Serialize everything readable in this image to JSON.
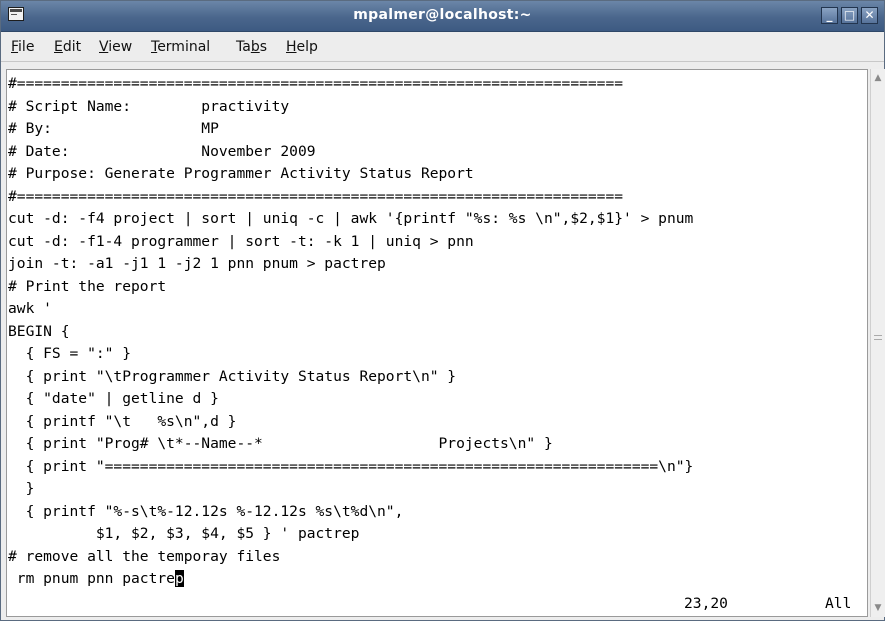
{
  "window": {
    "title": "mpalmer@localhost:~",
    "buttons": {
      "minimize": "_",
      "maximize": "□",
      "close": "✕"
    }
  },
  "menubar": [
    {
      "key": "F",
      "rest": "ile"
    },
    {
      "key": "E",
      "rest": "dit"
    },
    {
      "key": "V",
      "rest": "iew"
    },
    {
      "key": "T",
      "rest": "erminal"
    },
    {
      "pre": "Ta",
      "key": "b",
      "rest": "s"
    },
    {
      "key": "H",
      "rest": "elp"
    }
  ],
  "terminal": {
    "lines": [
      "#=====================================================================",
      "# Script Name:        practivity",
      "# By:                 MP",
      "# Date:               November 2009",
      "# Purpose: Generate Programmer Activity Status Report",
      "#=====================================================================",
      "cut -d: -f4 project | sort | uniq -c | awk '{printf \"%s: %s \\n\",$2,$1}' > pnum",
      "cut -d: -f1-4 programmer | sort -t: -k 1 | uniq > pnn",
      "join -t: -a1 -j1 1 -j2 1 pnn pnum > pactrep",
      "# Print the report",
      "awk '",
      "BEGIN {",
      "  { FS = \":\" }",
      "  { print \"\\tProgrammer Activity Status Report\\n\" }",
      "  { \"date\" | getline d }",
      "  { printf \"\\t   %s\\n\",d }",
      "  { print \"Prog# \\t*--Name--*                    Projects\\n\" }",
      "  { print \"===============================================================\\n\"}",
      "  }",
      "  { printf \"%-s\\t%-12.12s %-12.12s %s\\t%d\\n\",",
      "          $1, $2, $3, $4, $5 } ' pactrep",
      "# remove all the temporay files"
    ],
    "last_line_before_cursor": " rm pnum pnn pactre",
    "cursor_char": "p",
    "status_position": "23,20",
    "status_scroll": "All"
  },
  "scrollbar": {
    "up_arrow": "▲",
    "down_arrow": "▼"
  }
}
